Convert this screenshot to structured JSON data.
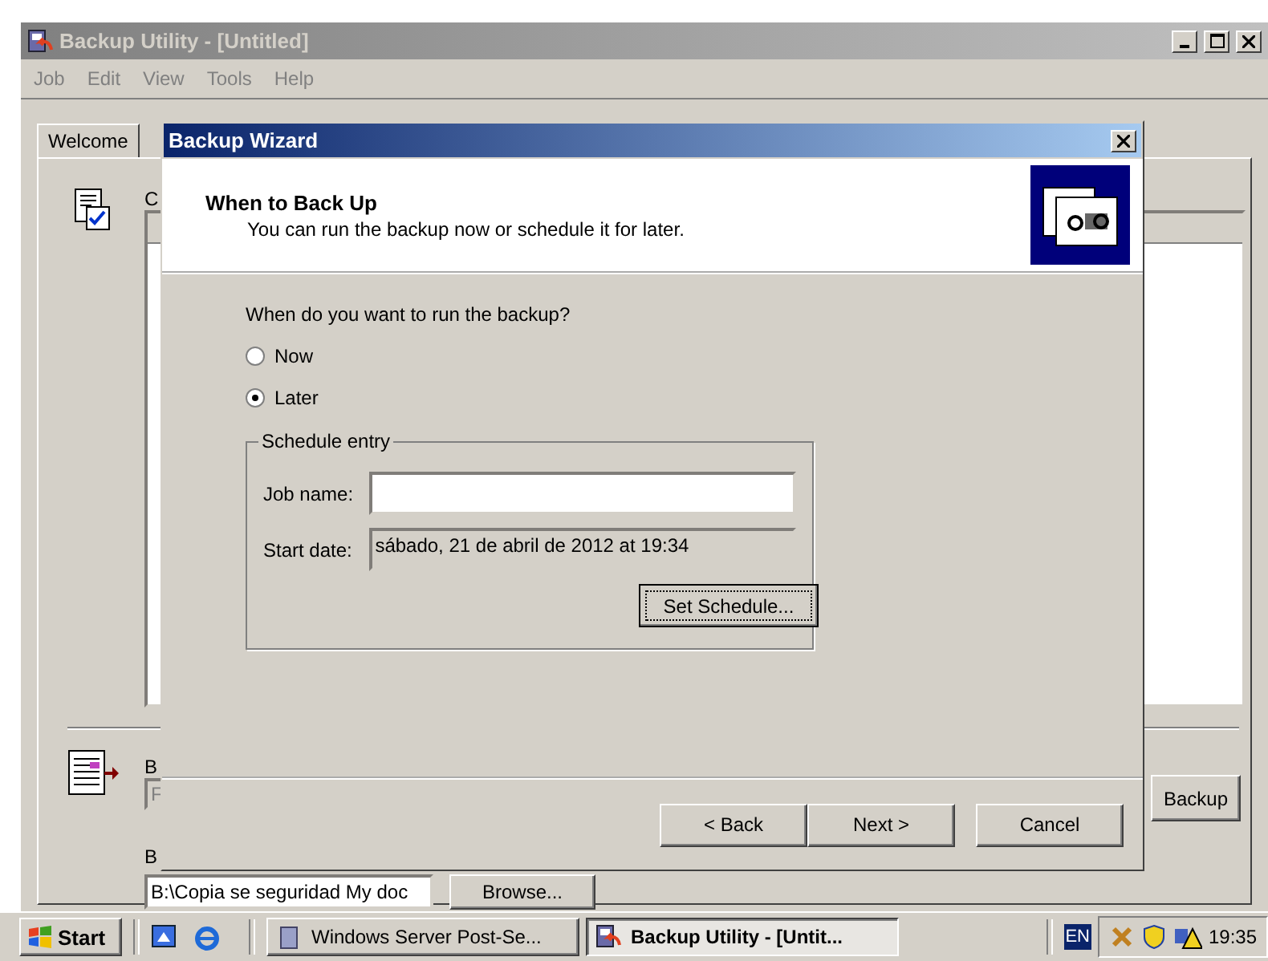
{
  "app_window": {
    "title": "Backup Utility - [Untitled]",
    "menu": [
      "Job",
      "Edit",
      "View",
      "Tools",
      "Help"
    ],
    "tabs": [
      {
        "label": "Welcome",
        "selected": true
      }
    ],
    "partial_labels": [
      "C",
      "B",
      "B"
    ],
    "partial_field": "F",
    "backup_button": "Backup",
    "path_field": {
      "value": "B:\\Copia se seguridad My doc"
    },
    "browse_button": "Browse..."
  },
  "dialog": {
    "title": "Backup Wizard",
    "heading": "When to Back Up",
    "subheading": "You can run the backup now or schedule it for later.",
    "question": "When do you want to run the backup?",
    "options": [
      {
        "label": "Now",
        "selected": false
      },
      {
        "label": "Later",
        "selected": true
      }
    ],
    "group": {
      "title": "Schedule entry",
      "job_name": {
        "label": "Job name:"
      },
      "start_date": {
        "label": "Start date:",
        "value": "sábado, 21 de abril de 2012 at 19:34"
      },
      "set_schedule_button": "Set Schedule..."
    },
    "buttons": [
      "< Back",
      "Next >",
      "Cancel"
    ]
  },
  "taskbar": {
    "start": "Start",
    "tasks": [
      {
        "label": "Windows Server Post-Se...",
        "selected": false
      },
      {
        "label": "Backup Utility - [Untit...",
        "selected": true
      }
    ],
    "language": "EN",
    "clock": "19:35"
  }
}
